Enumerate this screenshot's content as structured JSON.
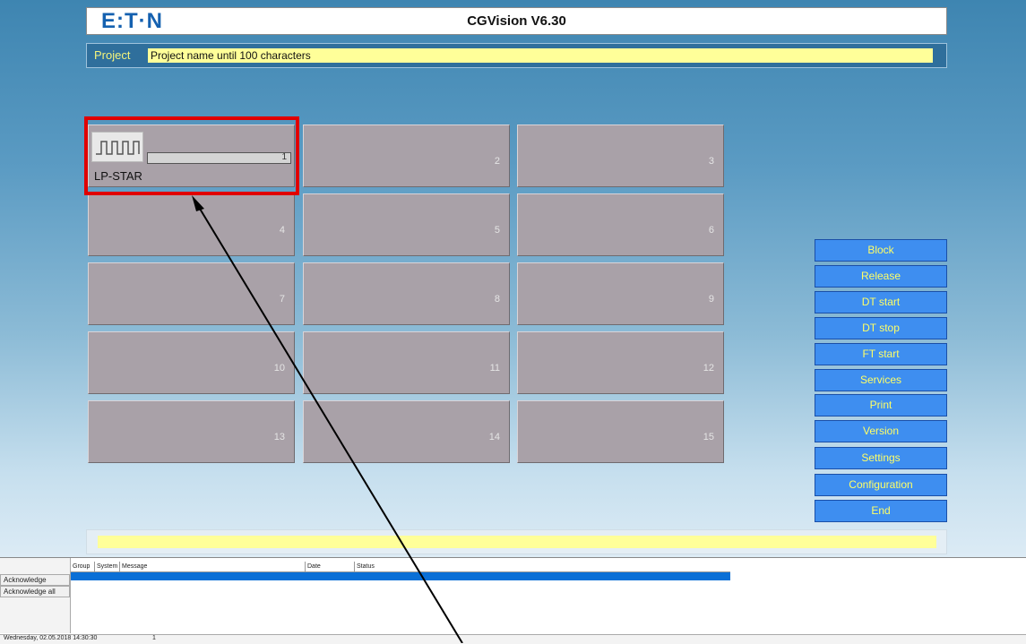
{
  "header": {
    "logo_text": "E:T·N",
    "title": "CGVision V6.30"
  },
  "project": {
    "label": "Project",
    "value": "Project name until 100 characters"
  },
  "tiles": [
    {
      "num": "1",
      "name": "LP-STAR"
    },
    {
      "num": "2"
    },
    {
      "num": "3"
    },
    {
      "num": "4"
    },
    {
      "num": "5"
    },
    {
      "num": "6"
    },
    {
      "num": "7"
    },
    {
      "num": "8"
    },
    {
      "num": "9"
    },
    {
      "num": "10"
    },
    {
      "num": "11"
    },
    {
      "num": "12"
    },
    {
      "num": "13"
    },
    {
      "num": "14"
    },
    {
      "num": "15"
    }
  ],
  "buttons": [
    {
      "label": "Block"
    },
    {
      "label": "Release"
    },
    {
      "label": "DT start"
    },
    {
      "label": "DT stop"
    },
    {
      "label": "FT start"
    },
    {
      "label": "Services"
    },
    {
      "label": "Print"
    },
    {
      "label": "Version"
    },
    {
      "label": "Settings"
    },
    {
      "label": "Configuration"
    },
    {
      "label": "End"
    }
  ],
  "log": {
    "acknowledge": "Acknowledge",
    "acknowledge_all": "Acknowledge all",
    "columns": {
      "group": "Group",
      "system": "System",
      "message": "Message",
      "date": "Date",
      "status": "Status"
    }
  },
  "status_bar": {
    "datetime": "Wednesday, 02.05.2018 14:30:30",
    "count": "1"
  },
  "colors": {
    "button_bg": "#3e8ef0",
    "button_text": "#ffff66",
    "tile_bg": "#a9a1a8",
    "highlight": "#e00000",
    "project_field": "#ffff99"
  }
}
